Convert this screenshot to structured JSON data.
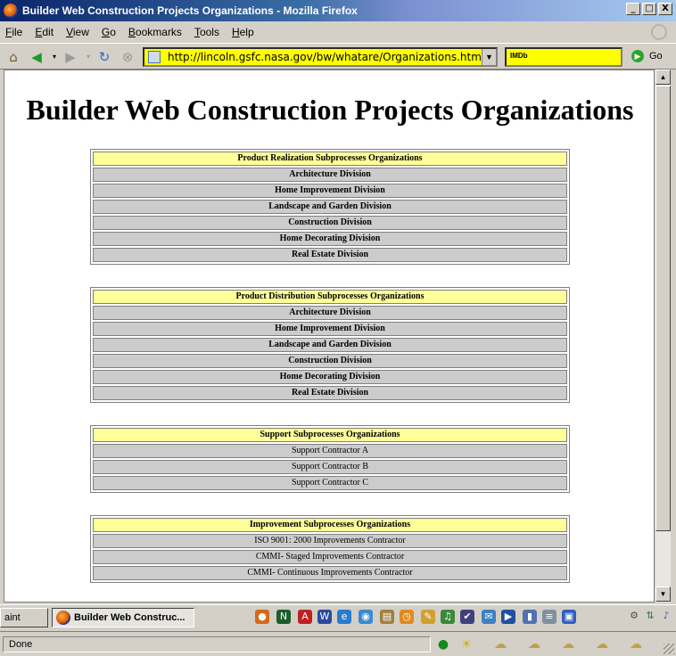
{
  "window": {
    "title": "Builder Web Construction Projects Organizations - Mozilla Firefox",
    "buttons": {
      "minimize": "_",
      "maximize": "□",
      "close": "X"
    }
  },
  "menu": [
    "File",
    "Edit",
    "View",
    "Go",
    "Bookmarks",
    "Tools",
    "Help"
  ],
  "menu_underline": [
    "F",
    "E",
    "V",
    "G",
    "B",
    "T",
    "H"
  ],
  "toolbar": {
    "url": "http://lincoln.gsfc.nasa.gov/bw/whatare/Organizations.htm",
    "search_engine": "IMDb",
    "go_label": "Go",
    "icons": [
      "home-icon",
      "back-icon",
      "forward-icon",
      "reload-icon",
      "stop-icon"
    ]
  },
  "page": {
    "title": "Builder Web Construction Projects Organizations",
    "tables": [
      {
        "header": "Product Realization Subprocesses Organizations",
        "bold_rows": true,
        "rows": [
          "Architecture Division",
          "Home Improvement Division",
          "Landscape and Garden Division",
          "Construction Division",
          "Home Decorating Division",
          "Real Estate Division"
        ]
      },
      {
        "header": "Product Distribution Subprocesses Organizations",
        "bold_rows": true,
        "rows": [
          "Architecture Division",
          "Home Improvement Division",
          "Landscape and Garden Division",
          "Construction Division",
          "Home Decorating Division",
          "Real Estate Division"
        ]
      },
      {
        "header": "Support Subprocesses Organizations",
        "bold_rows": false,
        "rows": [
          "Support Contractor A",
          "Support Contractor B",
          "Support Contractor C"
        ]
      },
      {
        "header": "Improvement Subprocesses Organizations",
        "bold_rows": false,
        "rows": [
          "ISO 9001: 2000 Improvements Contractor",
          "CMMI- Staged Improvements Contractor",
          "CMMI- Continuous Improvements Contractor"
        ]
      }
    ]
  },
  "taskbar": {
    "items": [
      "aint",
      "Builder Web Construc..."
    ]
  },
  "status": {
    "text": "Done"
  },
  "colors": {
    "url_bg": "#ffff00",
    "table_header_bg": "#ffff99",
    "table_row_bg": "#cccccc"
  }
}
